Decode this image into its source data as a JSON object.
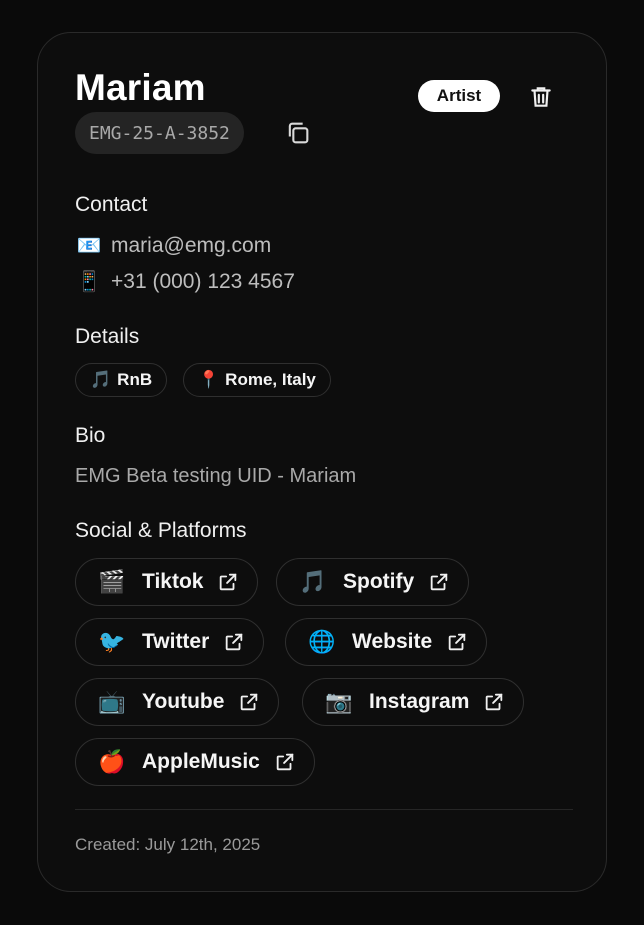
{
  "profile": {
    "name": "Mariam",
    "uid": "EMG-25-A-3852",
    "role": "Artist"
  },
  "contact": {
    "title": "Contact",
    "email_icon": "📧",
    "email": "maria@emg.com",
    "phone_icon": "📱",
    "phone": "+31 (000) 123 4567"
  },
  "details": {
    "title": "Details",
    "tags": [
      {
        "icon": "🎵",
        "label": "RnB"
      },
      {
        "icon": "📍",
        "label": "Rome, Italy"
      }
    ]
  },
  "bio": {
    "title": "Bio",
    "text": "EMG Beta testing UID - Mariam"
  },
  "social": {
    "title": "Social & Platforms",
    "platforms": [
      {
        "icon": "🎬",
        "label": "Tiktok"
      },
      {
        "icon": "🎵",
        "label": "Spotify"
      },
      {
        "icon": "🐦",
        "label": "Twitter"
      },
      {
        "icon": "🌐",
        "label": "Website"
      },
      {
        "icon": "📺",
        "label": "Youtube"
      },
      {
        "icon": "📷",
        "label": "Instagram"
      },
      {
        "icon": "🍎",
        "label": "AppleMusic"
      }
    ]
  },
  "footer": {
    "created": "Created: July 12th, 2025"
  },
  "colors": {
    "background": "#0a0a0a",
    "card": "#0d0d0d",
    "border": "#2a2a2a",
    "text": "#f2f2f2",
    "muted": "#a9a9a9",
    "badge_bg": "#ffffff"
  }
}
